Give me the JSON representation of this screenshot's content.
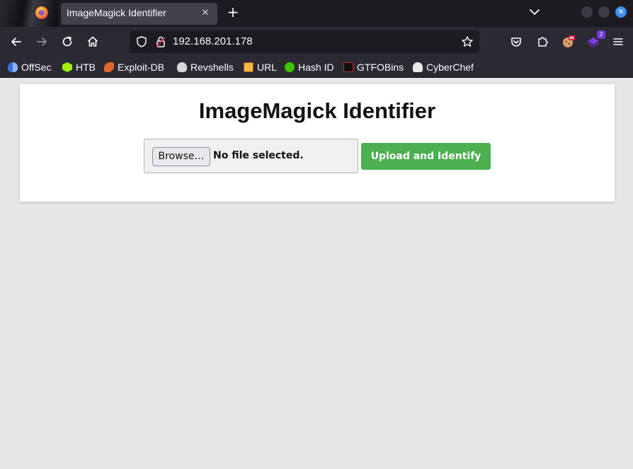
{
  "browser": {
    "tab_title": "ImageMagick Identifier",
    "url": "192.168.201.178",
    "extension_badge": "2"
  },
  "bookmarks": [
    {
      "label": "OffSec",
      "icon": "offsec-icon"
    },
    {
      "label": "HTB",
      "icon": "htb-icon"
    },
    {
      "label": "Exploit-DB",
      "icon": "exploit-db-icon"
    },
    {
      "label": "Revshells",
      "icon": "skull-icon"
    },
    {
      "label": "URL",
      "icon": "url-icon"
    },
    {
      "label": "Hash ID",
      "icon": "hash-id-icon"
    },
    {
      "label": "GTFOBins",
      "icon": "gtfobins-icon"
    },
    {
      "label": "CyberChef",
      "icon": "cyberchef-icon"
    }
  ],
  "page": {
    "title": "ImageMagick Identifier",
    "browse_label": "Browse…",
    "file_status": "No file selected.",
    "submit_label": "Upload and Identify"
  },
  "colors": {
    "accent_button": "#4caf50",
    "page_background": "#e6e6e6",
    "browser_chrome": "#2b2a33"
  }
}
